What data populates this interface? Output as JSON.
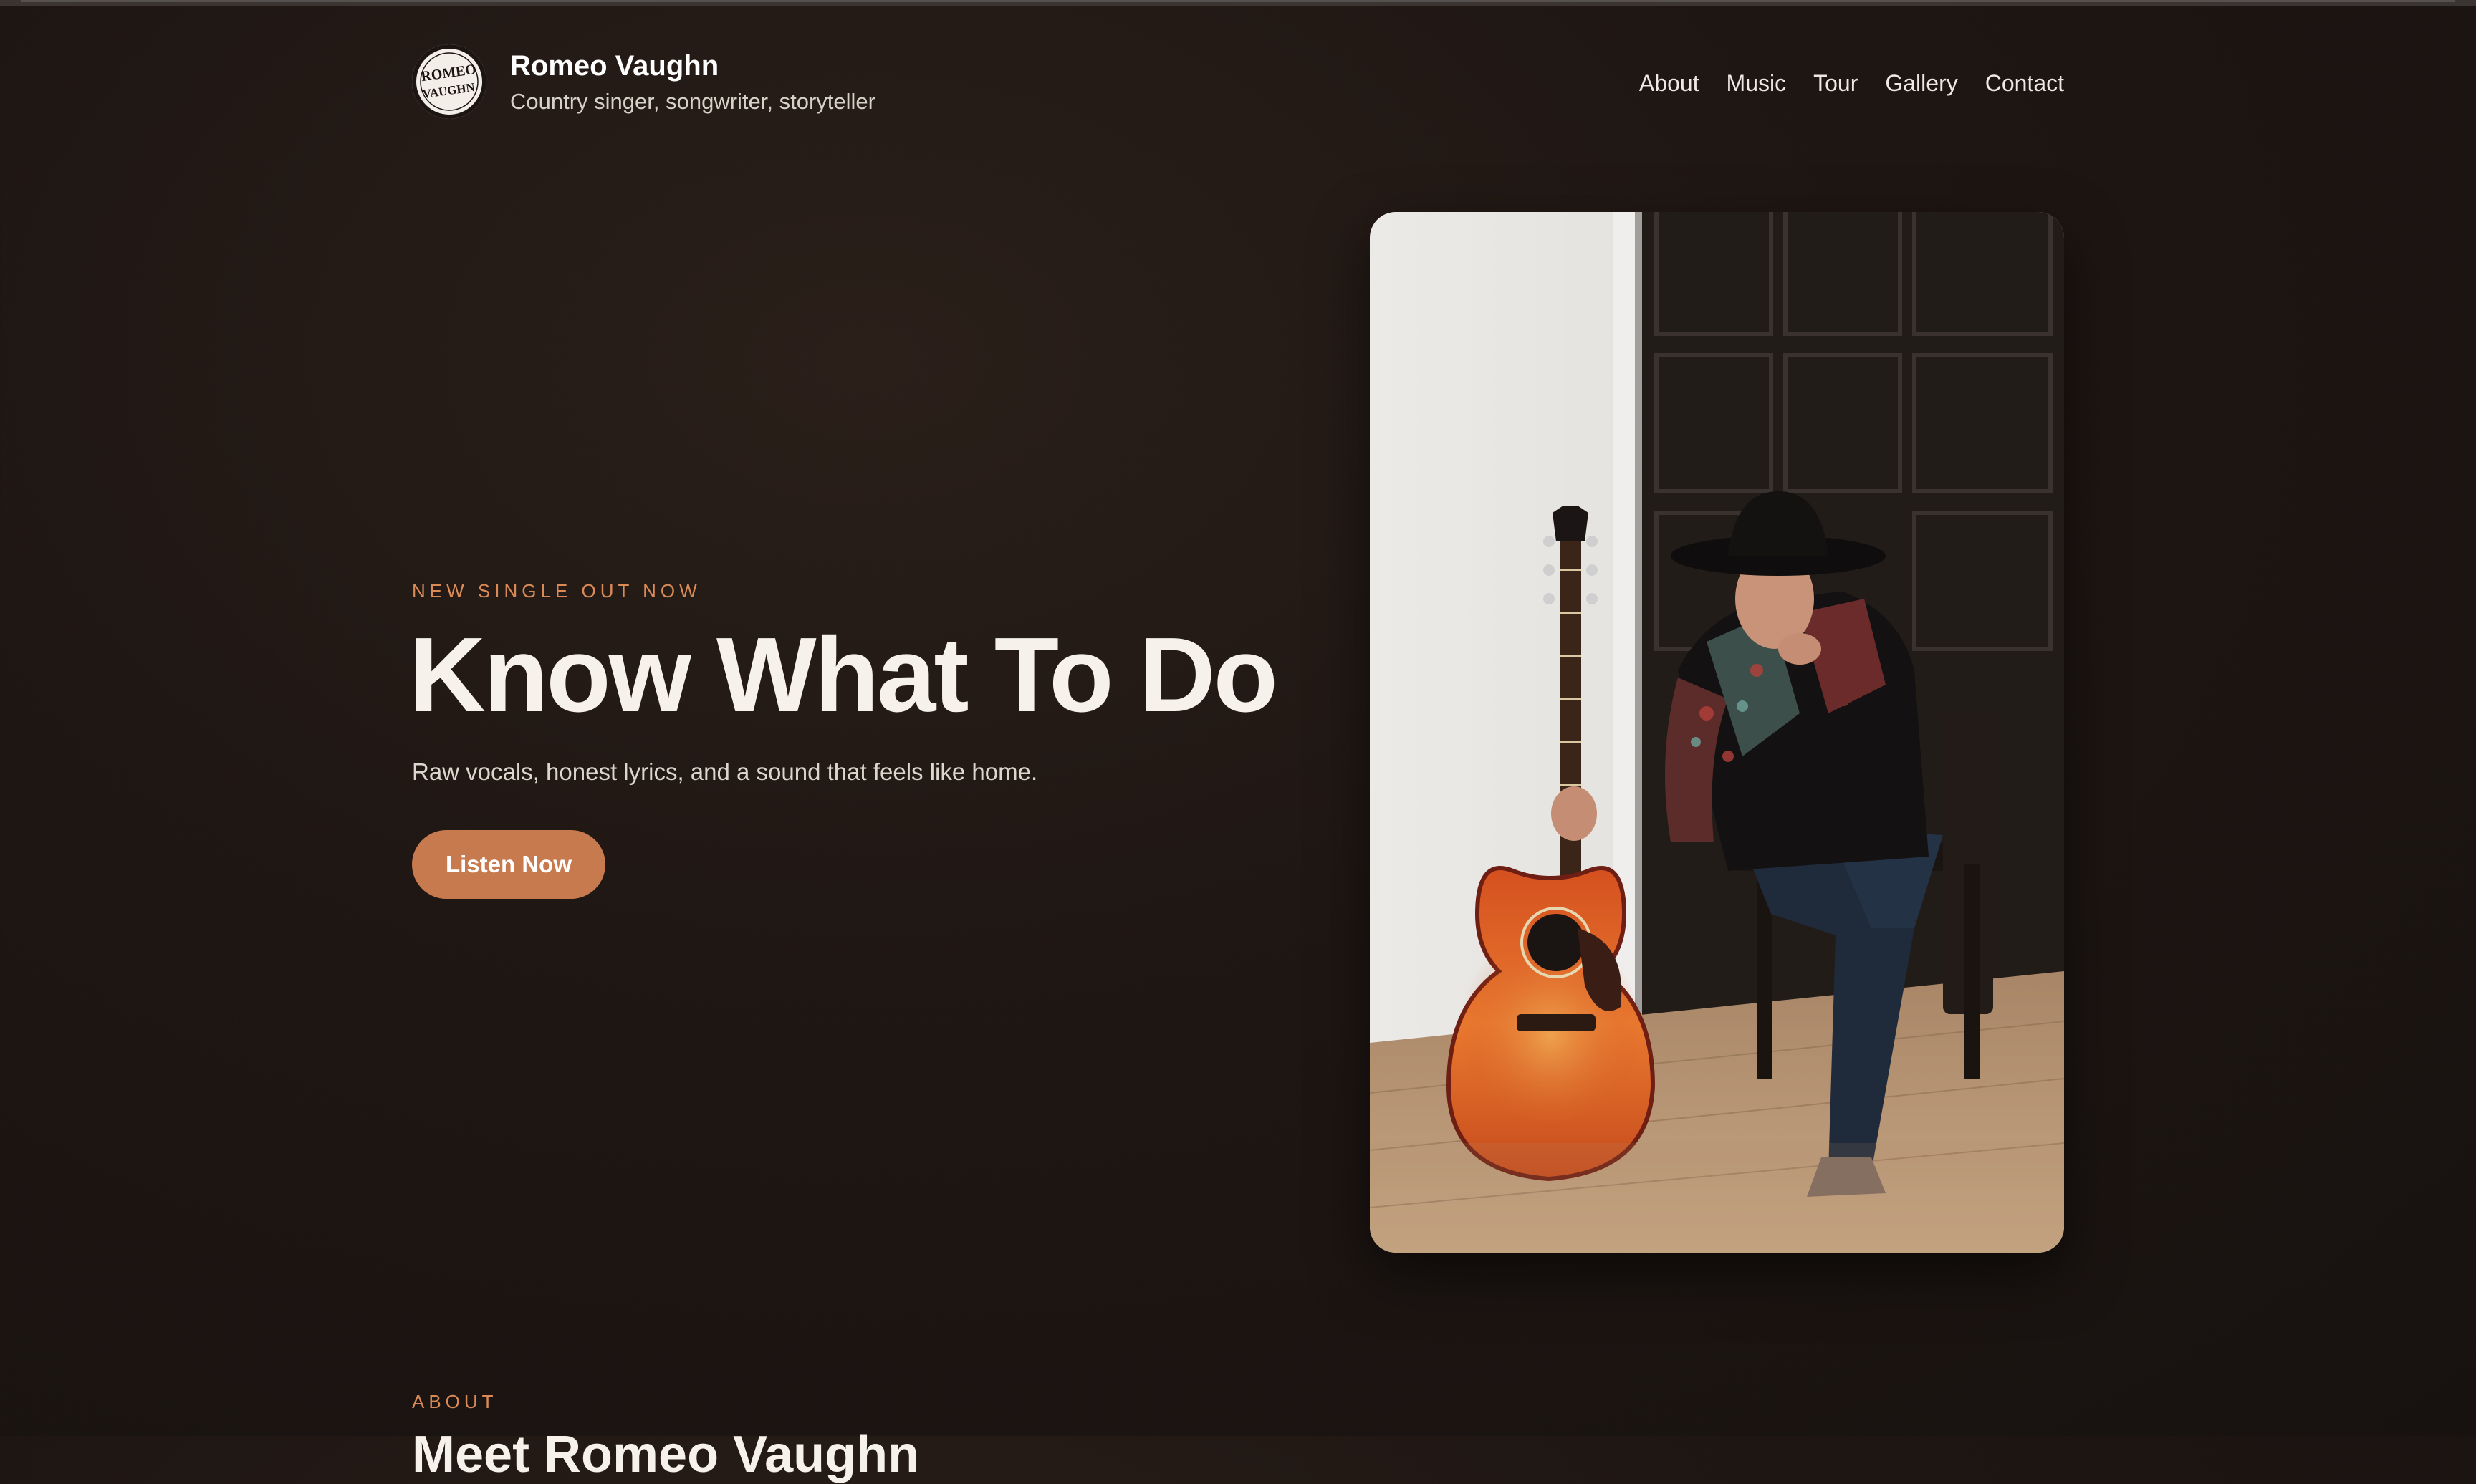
{
  "header": {
    "logo_text": "ROMEO VAUGHN",
    "brand_name": "Romeo Vaughn",
    "tagline": "Country singer, songwriter, storyteller"
  },
  "nav": {
    "items": [
      "About",
      "Music",
      "Tour",
      "Gallery",
      "Contact"
    ]
  },
  "hero": {
    "eyebrow": "NEW SINGLE OUT NOW",
    "title": "Know What To Do",
    "subtitle": "Raw vocals, honest lyrics, and a sound that feels like home.",
    "cta_label": "Listen Now",
    "accent_color": "#c87a4f",
    "image_icon": "artist-photo"
  },
  "about": {
    "eyebrow": "ABOUT",
    "title": "Meet Romeo Vaughn"
  },
  "colors": {
    "background": "#1e1613",
    "accent": "#d98a57",
    "button": "#c87a4f",
    "text": "#f6f1ea"
  }
}
